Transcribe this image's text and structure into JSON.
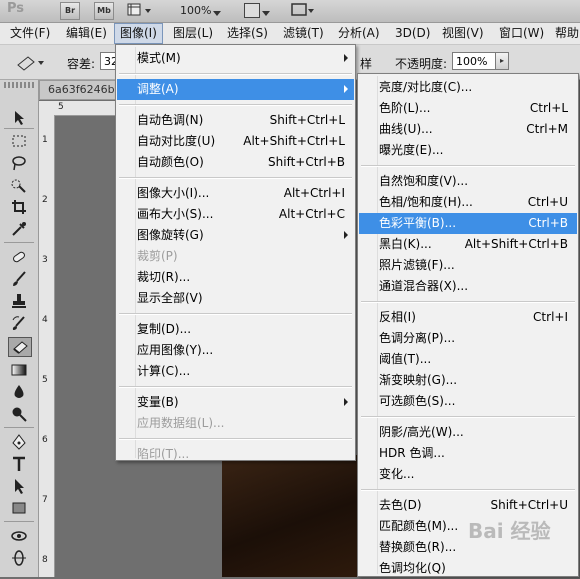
{
  "app": {
    "logo": "Ps",
    "bridge_label": "Br",
    "minibridge_label": "Mb",
    "zoom": "100%"
  },
  "menubar": [
    "文件(F)",
    "编辑(E)",
    "图像(I)",
    "图层(L)",
    "选择(S)",
    "滤镜(T)",
    "分析(A)",
    "3D(D)",
    "视图(V)",
    "窗口(W)",
    "帮助"
  ],
  "options": {
    "tolerance_label": "容差:",
    "tolerance_value": "32",
    "partial_label": "样",
    "opacity_label": "不透明度:",
    "opacity_value": "100%"
  },
  "document": {
    "tab": "6a63f6246b",
    "ruler_top": [
      "5"
    ],
    "ruler_left": [
      "1",
      "2",
      "3",
      "4",
      "5",
      "6",
      "7",
      "8",
      "9"
    ]
  },
  "image_menu": [
    {
      "label": "模式(M)",
      "shortcut": "",
      "submenu": true
    },
    {
      "sep": true
    },
    {
      "label": "调整(A)",
      "shortcut": "",
      "submenu": true,
      "highlight": true
    },
    {
      "sep": true
    },
    {
      "label": "自动色调(N)",
      "shortcut": "Shift+Ctrl+L"
    },
    {
      "label": "自动对比度(U)",
      "shortcut": "Alt+Shift+Ctrl+L"
    },
    {
      "label": "自动颜色(O)",
      "shortcut": "Shift+Ctrl+B"
    },
    {
      "sep": true
    },
    {
      "label": "图像大小(I)...",
      "shortcut": "Alt+Ctrl+I"
    },
    {
      "label": "画布大小(S)...",
      "shortcut": "Alt+Ctrl+C"
    },
    {
      "label": "图像旋转(G)",
      "shortcut": "",
      "submenu": true
    },
    {
      "label": "裁剪(P)",
      "shortcut": "",
      "disabled": true
    },
    {
      "label": "裁切(R)...",
      "shortcut": ""
    },
    {
      "label": "显示全部(V)",
      "shortcut": ""
    },
    {
      "sep": true
    },
    {
      "label": "复制(D)...",
      "shortcut": ""
    },
    {
      "label": "应用图像(Y)...",
      "shortcut": ""
    },
    {
      "label": "计算(C)...",
      "shortcut": ""
    },
    {
      "sep": true
    },
    {
      "label": "变量(B)",
      "shortcut": "",
      "submenu": true
    },
    {
      "label": "应用数据组(L)...",
      "shortcut": "",
      "disabled": true
    },
    {
      "sep": true
    },
    {
      "label": "陷印(T)...",
      "shortcut": "",
      "disabled": true
    }
  ],
  "adjust_menu": [
    {
      "label": "亮度/对比度(C)...",
      "shortcut": ""
    },
    {
      "label": "色阶(L)...",
      "shortcut": "Ctrl+L"
    },
    {
      "label": "曲线(U)...",
      "shortcut": "Ctrl+M"
    },
    {
      "label": "曝光度(E)...",
      "shortcut": ""
    },
    {
      "sep": true
    },
    {
      "label": "自然饱和度(V)...",
      "shortcut": ""
    },
    {
      "label": "色相/饱和度(H)...",
      "shortcut": "Ctrl+U"
    },
    {
      "label": "色彩平衡(B)...",
      "shortcut": "Ctrl+B",
      "highlight": true
    },
    {
      "label": "黑白(K)...",
      "shortcut": "Alt+Shift+Ctrl+B"
    },
    {
      "label": "照片滤镜(F)...",
      "shortcut": ""
    },
    {
      "label": "通道混合器(X)...",
      "shortcut": ""
    },
    {
      "sep": true
    },
    {
      "label": "反相(I)",
      "shortcut": "Ctrl+I"
    },
    {
      "label": "色调分离(P)...",
      "shortcut": ""
    },
    {
      "label": "阈值(T)...",
      "shortcut": ""
    },
    {
      "label": "渐变映射(G)...",
      "shortcut": ""
    },
    {
      "label": "可选颜色(S)...",
      "shortcut": ""
    },
    {
      "sep": true
    },
    {
      "label": "阴影/高光(W)...",
      "shortcut": ""
    },
    {
      "label": "HDR 色调...",
      "shortcut": ""
    },
    {
      "label": "变化...",
      "shortcut": ""
    },
    {
      "sep": true
    },
    {
      "label": "去色(D)",
      "shortcut": "Shift+Ctrl+U"
    },
    {
      "label": "匹配颜色(M)...",
      "shortcut": ""
    },
    {
      "label": "替换颜色(R)...",
      "shortcut": ""
    },
    {
      "label": "色调均化(Q)",
      "shortcut": ""
    }
  ],
  "toolbox_icons": [
    "move-icon",
    "marquee-icon",
    "lasso-icon",
    "quick-select-icon",
    "crop-icon",
    "eyedropper-icon",
    "healing-brush-icon",
    "brush-icon",
    "clone-stamp-icon",
    "history-brush-icon",
    "eraser-icon",
    "gradient-icon",
    "blur-icon",
    "dodge-icon",
    "pen-icon",
    "type-icon",
    "path-select-icon",
    "rectangle-icon",
    "3d-rotate-icon",
    "3d-orbit-icon"
  ],
  "colors": {
    "highlight": "#3e8fe6",
    "menu_bg": "#f1f1f1",
    "disabled": "#9c9c9c"
  }
}
